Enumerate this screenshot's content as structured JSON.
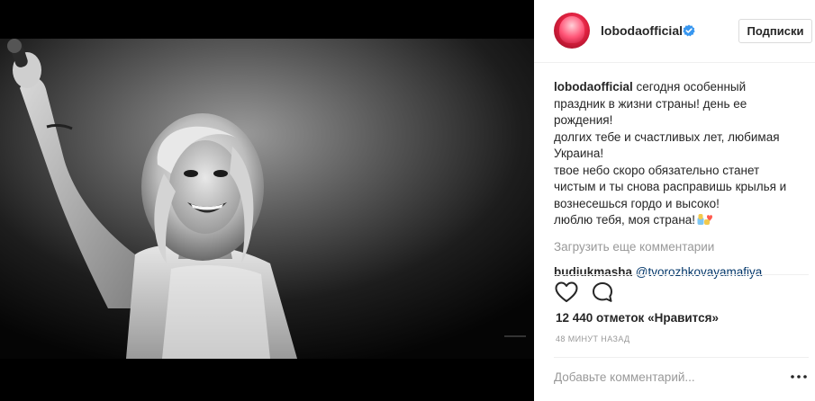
{
  "post": {
    "image_alt": "Black and white concert photo of a smiling blonde singer raising her arm with a microphone",
    "author": {
      "username": "lobodaofficial",
      "verified": true,
      "avatar_icon": "profile-avatar"
    },
    "follow_label": "Подписки",
    "caption": {
      "username": "lobodaofficial",
      "lines": [
        "сегодня особенный",
        "праздник в жизни страны! день ее",
        "рождения!",
        "долгих тебе и счастливых лет, любимая",
        "Украина!",
        "твое небо скоро обязательно станет",
        "чистым и ты снова расправишь крылья и",
        "вознесешься гордо и высоко!",
        "люблю тебя, моя страна!"
      ],
      "emoji": "raised-hands-heart-emoji"
    },
    "load_more_label": "Загрузить еще комментарии",
    "comments": [
      {
        "username": "budiukmasha",
        "text": "@tvorozhkovayamafiya"
      }
    ],
    "likes_text": "12 440 отметок «Нравится»",
    "timestamp": "48 МИНУТ НАЗАД",
    "comment_placeholder": "Добавьте комментарий...",
    "icons": {
      "like": "heart-outline-icon",
      "comment": "comment-bubble-icon",
      "more": "more-options-icon",
      "verified": "verified-badge-icon"
    },
    "colors": {
      "verified_blue": "#3897f0",
      "link": "#003569",
      "muted": "#999999",
      "text": "#262626"
    }
  }
}
